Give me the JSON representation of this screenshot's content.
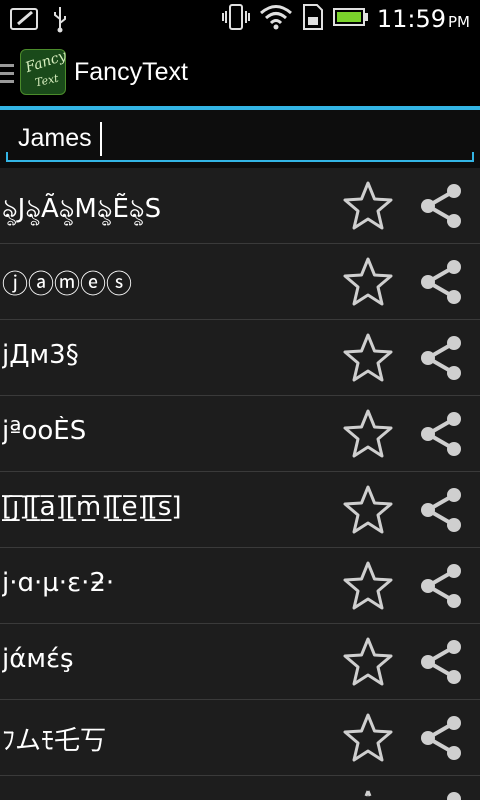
{
  "status_bar": {
    "time": "11:59",
    "ampm": "PM"
  },
  "action_bar": {
    "title": "FancyText",
    "app_icon_line1": "Fancy",
    "app_icon_line2": "Text"
  },
  "search": {
    "value": "James"
  },
  "items": [
    {
      "text": "ৡJৡÃৡMৡẼৡS"
    },
    {
      "text": "ⓙⓐⓜⓔⓢ"
    },
    {
      "text": "jДм3§"
    },
    {
      "text": "jªooÈS"
    },
    {
      "text": "[̲̅j̲̅][̲̅a̲̅][̲̅m̲̅][̲̅e̲̅][̲̅s̲̅]"
    },
    {
      "text": "j·ɑ·µ·ε·ƻ·"
    },
    {
      "text": "jάмέş"
    },
    {
      "text": "ﾌムﾓ乇丂"
    }
  ],
  "colors": {
    "accent": "#33b5e5",
    "background": "#1b1b1b",
    "bar": "#000000"
  }
}
